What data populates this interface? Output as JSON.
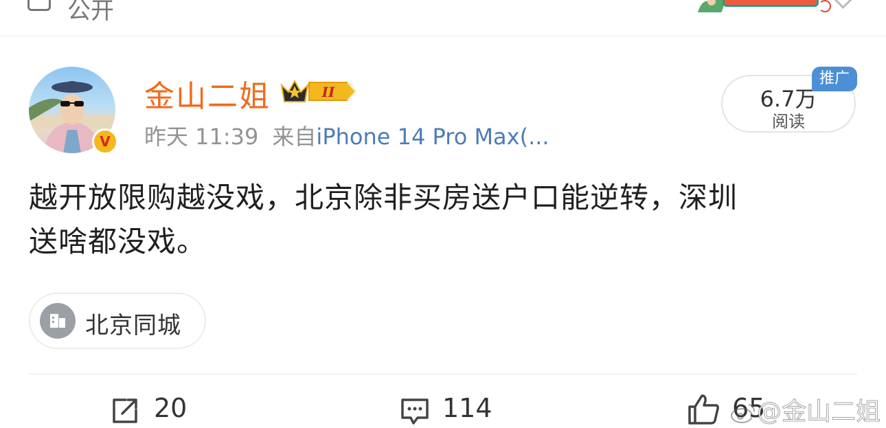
{
  "top_bar": {
    "visibility_label": "公开"
  },
  "post": {
    "author": {
      "name": "金山二姐",
      "verified_badge": "V",
      "vip_level": "II"
    },
    "meta": {
      "time": "昨天 11:39",
      "source_prefix": "来自",
      "source": "iPhone 14 Pro Max(..."
    },
    "reads": {
      "count": "6.7万",
      "label": "阅读"
    },
    "ad_tag": "推广",
    "text_lines": [
      "越开放限购越没戏，北京除非买房送户口能逆转，深圳",
      "送啥都没戏。"
    ],
    "topic_tag": "北京同城"
  },
  "actions": {
    "repost_count": "20",
    "comment_count": "114",
    "like_count": "65"
  },
  "watermark": "@金山二姐",
  "colors": {
    "username": "#ef6b1c",
    "source_link": "#4d7cb8",
    "ad_tag": "#4c8fd7",
    "verified_badge": "#f3b81b"
  },
  "icons": [
    "visibility-icon",
    "decorative-figure-icon",
    "chevron-down-icon",
    "verified-v-icon",
    "vip-crown-icon",
    "location-building-icon",
    "repost-icon",
    "comment-icon",
    "like-icon",
    "weibo-logo-icon"
  ]
}
